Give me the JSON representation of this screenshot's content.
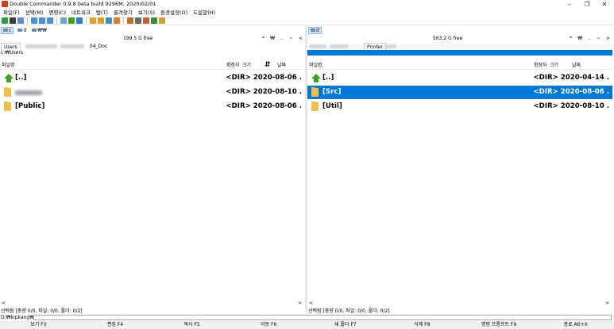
{
  "window": {
    "title": "Double Commander 0.9.8 beta build 9296M; 2020/02/01",
    "min": "–",
    "max": "❐",
    "close": "✕"
  },
  "menu": [
    "파일(F)",
    "선택(M)",
    "명령(C)",
    "네트워크",
    "탭(T)",
    "즐겨찾기",
    "보기(S)",
    "환경설정(O)",
    "도움말(H)"
  ],
  "left": {
    "drives": [
      {
        "label": "c",
        "selected": true
      },
      {
        "label": "d",
        "selected": false
      },
      {
        "label": "₩₩",
        "selected": false
      }
    ],
    "free": "199.5 G free",
    "pathbtns": [
      "*",
      "₩",
      "..",
      "~",
      "<"
    ],
    "tabs": [
      {
        "label": "Users",
        "active": true
      },
      {
        "label": "04_Doc",
        "active": false
      }
    ],
    "current_path": "c:₩Users",
    "headers": {
      "name": "파일명",
      "ext": "확장자",
      "size": "크기",
      "sort_icon": "⇵",
      "date": "날짜"
    },
    "files": [
      {
        "name": "[..]",
        "info": "<DIR> 2020-08-06 .",
        "icon": "up-arrow",
        "selected": false,
        "blurred": false
      },
      {
        "name": "",
        "info": "<DIR> 2020-08-10 .",
        "icon": "folder",
        "selected": false,
        "blurred": true
      },
      {
        "name": "[Public]",
        "info": "<DIR> 2020-08-06 .",
        "icon": "folder",
        "selected": false,
        "blurred": false
      }
    ],
    "scroll_left": "<",
    "scroll_right": ">",
    "status": "선택됨 [총량 0/0, 파일: 0/0, 폴더: 0/2]"
  },
  "right": {
    "drives": [
      {
        "label": "d",
        "selected": true
      }
    ],
    "free": "563.2 G free",
    "pathbtns": [
      "*",
      "₩",
      "..",
      "~",
      ">"
    ],
    "tabs": [
      {
        "label": "Printer",
        "active": true
      }
    ],
    "current_path": "",
    "headers": {
      "name": "파일명",
      "ext": "확장자",
      "size": "크기",
      "sort_icon": "",
      "date": "날짜"
    },
    "files": [
      {
        "name": "[..]",
        "info": "<DIR> 2020-04-14 .",
        "icon": "up-arrow",
        "selected": false,
        "blurred": false
      },
      {
        "name": "[Src]",
        "info": "<DIR> 2020-08-06 .",
        "icon": "folder",
        "selected": true,
        "blurred": false
      },
      {
        "name": "[Util]",
        "info": "<DIR> 2020-08-10 .",
        "icon": "folder",
        "selected": false,
        "blurred": false
      }
    ],
    "scroll_left": "<",
    "scroll_right": ">",
    "status": "선택됨 [총량 0/0, 파일: 0/0, 폴더: 0/2]"
  },
  "cmdline": {
    "label": "D:₩kipkang₩>"
  },
  "fkeys": [
    "보기 F3",
    "편집 F4",
    "복사 F5",
    "이동 F6",
    "새 폴더 F7",
    "삭제 F8",
    "명령 프롬프트 F9",
    "종료 Alt+X"
  ],
  "colors": {
    "selection": "#0078d7",
    "folder": "#f0c04a",
    "up_arrow": "#3aa41c",
    "app_icon": "#d23a1c"
  }
}
